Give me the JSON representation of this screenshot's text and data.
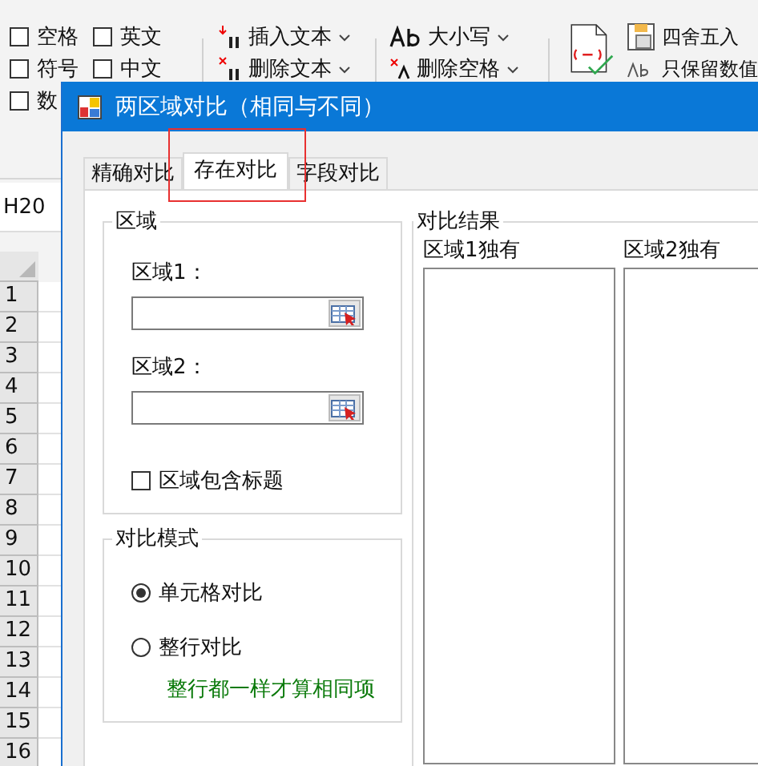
{
  "ribbon": {
    "options": [
      {
        "label": "空格",
        "checked": false
      },
      {
        "label": "英文",
        "checked": false
      },
      {
        "label": "符号",
        "checked": false
      },
      {
        "label": "中文",
        "checked": false
      },
      {
        "label": "数",
        "checked": false
      }
    ],
    "text_commands": [
      {
        "label": "插入文本",
        "dropdown": true
      },
      {
        "label": "删除文本",
        "dropdown": true
      }
    ],
    "case_commands": [
      {
        "label": "大小写",
        "dropdown": true
      },
      {
        "label": "删除空格",
        "dropdown": true
      }
    ],
    "number_commands": [
      {
        "label": "四舍五入"
      },
      {
        "label": "只保留数值"
      }
    ]
  },
  "name_box": "H20",
  "row_headers": [
    "1",
    "2",
    "3",
    "4",
    "5",
    "6",
    "7",
    "8",
    "9",
    "10",
    "11",
    "12",
    "13",
    "14",
    "15",
    "16"
  ],
  "dialog": {
    "title": "两区域对比（相同与不同）",
    "tabs": [
      {
        "label": "精确对比",
        "selected": false,
        "highlighted": false
      },
      {
        "label": "存在对比",
        "selected": true,
        "highlighted": true
      },
      {
        "label": "字段对比",
        "selected": false,
        "highlighted": false
      }
    ],
    "region_group": {
      "title": "区域",
      "fields": [
        {
          "label": "区域1："
        },
        {
          "label": "区域2："
        }
      ],
      "header_option": {
        "label": "区域包含标题",
        "checked": false
      }
    },
    "mode_group": {
      "title": "对比模式",
      "options": [
        {
          "label": "单元格对比",
          "selected": true
        },
        {
          "label": "整行对比",
          "selected": false
        }
      ],
      "hint": "整行都一样才算相同项"
    },
    "result_group": {
      "title": "对比结果",
      "lists": [
        {
          "label": "区域1独有"
        },
        {
          "label": "区域2独有"
        }
      ]
    }
  }
}
